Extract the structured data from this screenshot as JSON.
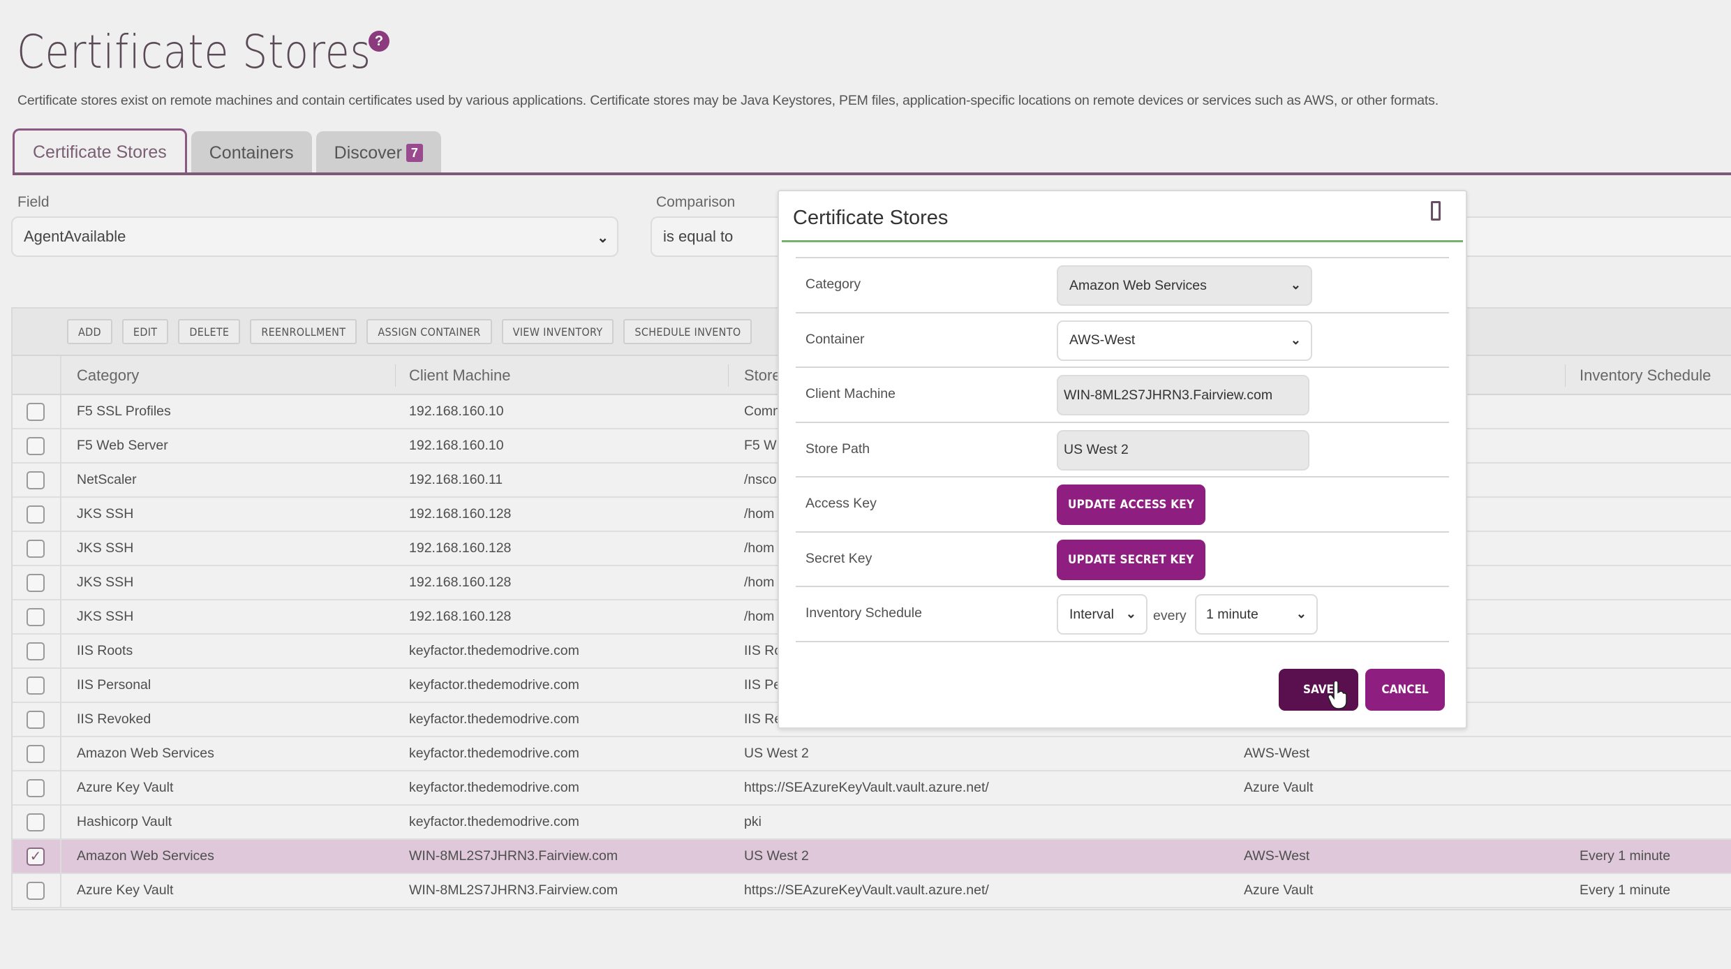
{
  "page": {
    "title": "Certificate Stores",
    "help_icon": "question-circle-icon",
    "description": "Certificate stores exist on remote machines and contain certificates used by various applications. Certificate stores may be Java Keystores, PEM files, application-specific locations on remote devices or services such as AWS, or other formats."
  },
  "tabs": [
    {
      "label": "Certificate Stores",
      "active": true
    },
    {
      "label": "Containers",
      "active": false
    },
    {
      "label": "Discover",
      "active": false,
      "badge": "7"
    }
  ],
  "filter": {
    "field_label": "Field",
    "field_value": "AgentAvailable",
    "comparison_label": "Comparison",
    "comparison_value": "is equal to"
  },
  "toolbar": {
    "buttons": [
      "ADD",
      "EDIT",
      "DELETE",
      "REENROLLMENT",
      "ASSIGN CONTAINER",
      "VIEW INVENTORY",
      "SCHEDULE INVENTO"
    ]
  },
  "table": {
    "columns": [
      "Category",
      "Client Machine",
      "Store",
      "Inventory Schedule"
    ],
    "rows": [
      {
        "checked": false,
        "category": "F5 SSL Profiles",
        "client": "192.168.160.10",
        "store": "Comm",
        "container": "",
        "schedule": ""
      },
      {
        "checked": false,
        "category": "F5 Web Server",
        "client": "192.168.160.10",
        "store": "F5 W",
        "container": "",
        "schedule": ""
      },
      {
        "checked": false,
        "category": "NetScaler",
        "client": "192.168.160.11",
        "store": "/nsco",
        "container": "",
        "schedule": ""
      },
      {
        "checked": false,
        "category": "JKS SSH",
        "client": "192.168.160.128",
        "store": "/hom",
        "container": "",
        "schedule": ""
      },
      {
        "checked": false,
        "category": "JKS SSH",
        "client": "192.168.160.128",
        "store": "/hom",
        "container": "",
        "schedule": ""
      },
      {
        "checked": false,
        "category": "JKS SSH",
        "client": "192.168.160.128",
        "store": "/hom",
        "container": "",
        "schedule": ""
      },
      {
        "checked": false,
        "category": "JKS SSH",
        "client": "192.168.160.128",
        "store": "/hom",
        "container": "",
        "schedule": ""
      },
      {
        "checked": false,
        "category": "IIS Roots",
        "client": "keyfactor.thedemodrive.com",
        "store": "IIS Ro",
        "container": "",
        "schedule": ""
      },
      {
        "checked": false,
        "category": "IIS Personal",
        "client": "keyfactor.thedemodrive.com",
        "store": "IIS Pe",
        "container": "",
        "schedule": ""
      },
      {
        "checked": false,
        "category": "IIS Revoked",
        "client": "keyfactor.thedemodrive.com",
        "store": "IIS Re",
        "container": "",
        "schedule": ""
      },
      {
        "checked": false,
        "category": "Amazon Web Services",
        "client": "keyfactor.thedemodrive.com",
        "store": "US West 2",
        "container": "AWS-West",
        "schedule": ""
      },
      {
        "checked": false,
        "category": "Azure Key Vault",
        "client": "keyfactor.thedemodrive.com",
        "store": "https://SEAzureKeyVault.vault.azure.net/",
        "container": "Azure Vault",
        "schedule": ""
      },
      {
        "checked": false,
        "category": "Hashicorp Vault",
        "client": "keyfactor.thedemodrive.com",
        "store": "pki",
        "container": "",
        "schedule": ""
      },
      {
        "checked": true,
        "category": "Amazon Web Services",
        "client": "WIN-8ML2S7JHRN3.Fairview.com",
        "store": "US West 2",
        "container": "AWS-West",
        "schedule": "Every 1 minute"
      },
      {
        "checked": false,
        "category": "Azure Key Vault",
        "client": "WIN-8ML2S7JHRN3.Fairview.com",
        "store": "https://SEAzureKeyVault.vault.azure.net/",
        "container": "Azure Vault",
        "schedule": "Every 1 minute"
      }
    ]
  },
  "modal": {
    "title": "Certificate Stores",
    "close_icon": "close-icon",
    "fields": {
      "category_label": "Category",
      "category_value": "Amazon Web Services",
      "container_label": "Container",
      "container_value": "AWS-West",
      "client_label": "Client Machine",
      "client_value": "WIN-8ML2S7JHRN3.Fairview.com",
      "store_path_label": "Store Path",
      "store_path_value": "US West 2",
      "access_key_label": "Access Key",
      "access_key_button": "UPDATE ACCESS KEY",
      "secret_key_label": "Secret Key",
      "secret_key_button": "UPDATE SECRET KEY",
      "schedule_label": "Inventory Schedule",
      "schedule_type": "Interval",
      "schedule_every": "every",
      "schedule_frequency": "1 minute"
    },
    "save_label": "SAVE",
    "cancel_label": "CANCEL"
  },
  "colors": {
    "brand_purple": "#8e1f80",
    "save_dark_purple": "#5a0f4f",
    "tab_underline": "#7e5a78",
    "modal_rule_green": "#78b06e",
    "selected_row": "#dfc8d9"
  }
}
